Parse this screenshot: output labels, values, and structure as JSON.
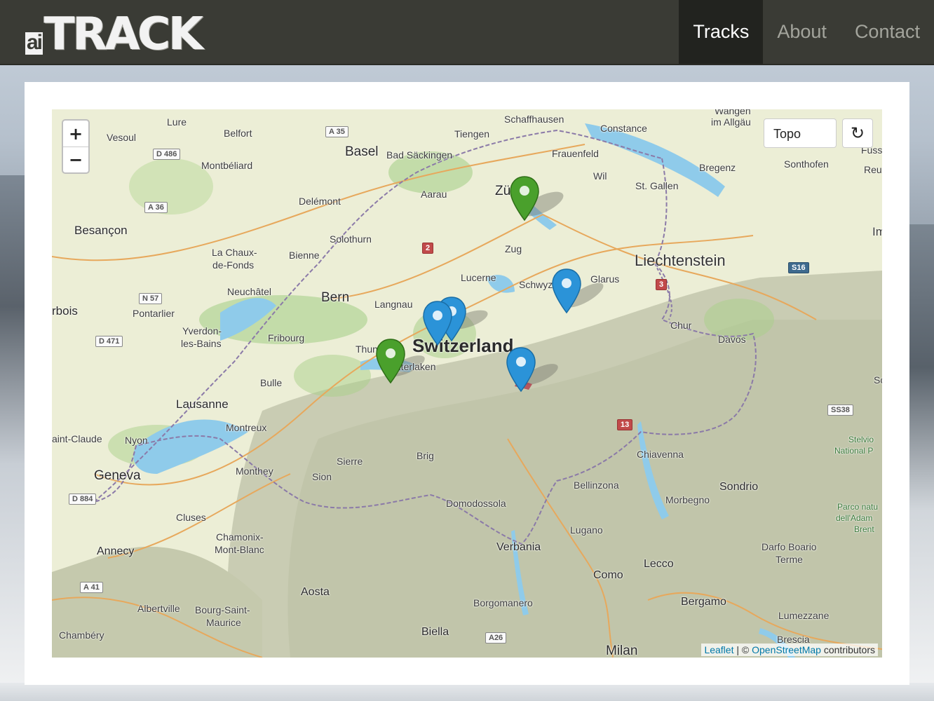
{
  "brand": {
    "prefix": "ai",
    "name": "TRACK"
  },
  "nav": {
    "items": [
      "Tracks",
      "About",
      "Contact"
    ],
    "active": "Tracks"
  },
  "map": {
    "zoom_in": "+",
    "zoom_out": "−",
    "layer_selected": "Topo",
    "refresh_icon": "↻",
    "attribution": {
      "leaflet": "Leaflet",
      "separator": "| ©",
      "osm": "OpenStreetMap",
      "suffix": "contributors"
    },
    "labels": {
      "wangen": "Wangen",
      "allgau": "im Allgäu",
      "lure": "Lure",
      "vesoul": "Vesoul",
      "belfort": "Belfort",
      "basel": "Basel",
      "bad_sackingen": "Bad Säckingen",
      "tiengen": "Tiengen",
      "schaffhausen": "Schaffhausen",
      "constance": "Constance",
      "frauenfeld": "Frauenfeld",
      "wil": "Wil",
      "bregenz": "Bregenz",
      "sonthofen": "Sonthofen",
      "fuss": "Füss",
      "reu": "Reu",
      "montbeliard": "Montbéliard",
      "st_gallen": "St. Gallen",
      "delemont": "Delémont",
      "aarau": "Aarau",
      "zurich": "Zürich",
      "besancon": "Besançon",
      "solothurn": "Solothurn",
      "im": "Im",
      "la_chaux": "La Chaux-",
      "de_fonds": "de-Fonds",
      "bienne": "Bienne",
      "zug": "Zug",
      "liechtenstein": "Liechtenstein",
      "neuchatel": "Neuchâtel",
      "lucerne": "Lucerne",
      "schwyz": "Schwyz",
      "glarus": "Glarus",
      "bern": "Bern",
      "langnau": "Langnau",
      "bois": "rbois",
      "pontarlier": "Pontarlier",
      "yverdon": "Yverdon-",
      "les_bains": "les-Bains",
      "fribourg": "Fribourg",
      "chur": "Chur",
      "davos": "Davos",
      "thun": "Thun",
      "interlaken": "Interlaken",
      "switzerland": "Switzerland",
      "bulle": "Bulle",
      "lausanne": "Lausanne",
      "montreux": "Montreux",
      "saint_claude": "aint-Claude",
      "nyon": "Nyon",
      "sierre": "Sierre",
      "brig": "Brig",
      "chiavenna": "Chiavenna",
      "schl": "Schl",
      "stelvio": "Stelvio",
      "national_p": "National P",
      "geneva": "Geneva",
      "monthey": "Monthey",
      "sion": "Sion",
      "bellinzona": "Bellinzona",
      "sondrio": "Sondrio",
      "morbegno": "Morbegno",
      "domodossola": "Domodossola",
      "cluses": "Cluses",
      "chamonix": "Chamonix-",
      "mont_blanc": "Mont-Blanc",
      "parco": "Parco natu",
      "adam": "dell'Adam",
      "brent": "Brent",
      "lugano": "Lugano",
      "annecy": "Annecy",
      "verbania": "Verbania",
      "darfo": "Darfo Boario",
      "terme": "Terme",
      "lecco": "Lecco",
      "como": "Como",
      "aosta": "Aosta",
      "bergamo": "Bergamo",
      "albertville": "Albertville",
      "bourg": "Bourg-Saint-",
      "maurice": "Maurice",
      "borgomanero": "Borgomanero",
      "lumezzane": "Lumezzane",
      "chambery": "Chambéry",
      "biella": "Biella",
      "brescia": "Brescia",
      "milan": "Milan"
    },
    "roads": {
      "a35": "A 35",
      "d486": "D 486",
      "a36": "A 36",
      "r2": "2",
      "s16": "S16",
      "r3": "3",
      "n57": "N 57",
      "d471": "D 471",
      "r13": "13",
      "ss38": "SS38",
      "d884": "D 884",
      "a41": "A 41",
      "a26": "A26"
    },
    "markers": [
      {
        "color": "#4aa02c"
      },
      {
        "color": "#2b93d8"
      },
      {
        "color": "#2b93d8"
      },
      {
        "color": "#2b93d8"
      },
      {
        "color": "#4aa02c"
      },
      {
        "color": "#2b93d8"
      }
    ]
  }
}
